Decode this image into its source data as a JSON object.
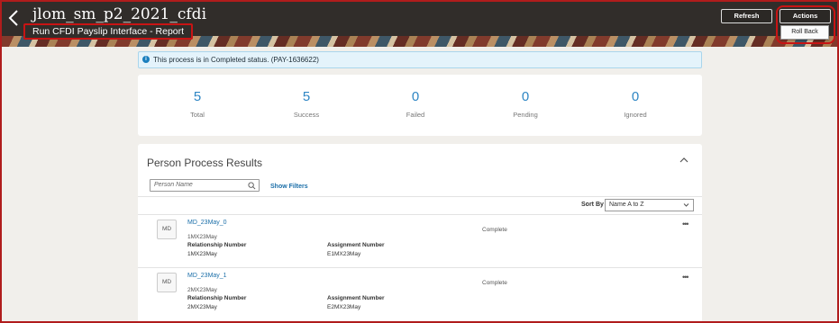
{
  "header": {
    "title": "jlom_sm_p2_2021_cfdi",
    "subtitle": "Run CFDI Payslip Interface - Report",
    "refresh_label": "Refresh",
    "actions_label": "Actions",
    "actions_menu": [
      "Roll Back"
    ]
  },
  "banner": {
    "message": "This process is in Completed status. (PAY-1636622)"
  },
  "stats": [
    {
      "value": "5",
      "label": "Total"
    },
    {
      "value": "5",
      "label": "Success"
    },
    {
      "value": "0",
      "label": "Failed"
    },
    {
      "value": "0",
      "label": "Pending"
    },
    {
      "value": "0",
      "label": "Ignored"
    }
  ],
  "results": {
    "title": "Person Process Results",
    "search_placeholder": "Person Name",
    "show_filters": "Show Filters",
    "sort_label": "Sort By",
    "sort_value": "Name A to Z",
    "relationship_label": "Relationship Number",
    "assignment_label": "Assignment Number",
    "rows": [
      {
        "initials": "MD",
        "name": "MD_23May_0",
        "person_number": "1MX23May",
        "relationship": "1MX23May",
        "assignment": "E1MX23May",
        "status": "Complete"
      },
      {
        "initials": "MD",
        "name": "MD_23May_1",
        "person_number": "2MX23May",
        "relationship": "2MX23May",
        "assignment": "E2MX23May",
        "status": "Complete"
      }
    ]
  },
  "colors": {
    "header_bg": "#312d2a",
    "accent": "#2f86c4",
    "link": "#1a6ea8",
    "highlight": "#c81414"
  }
}
